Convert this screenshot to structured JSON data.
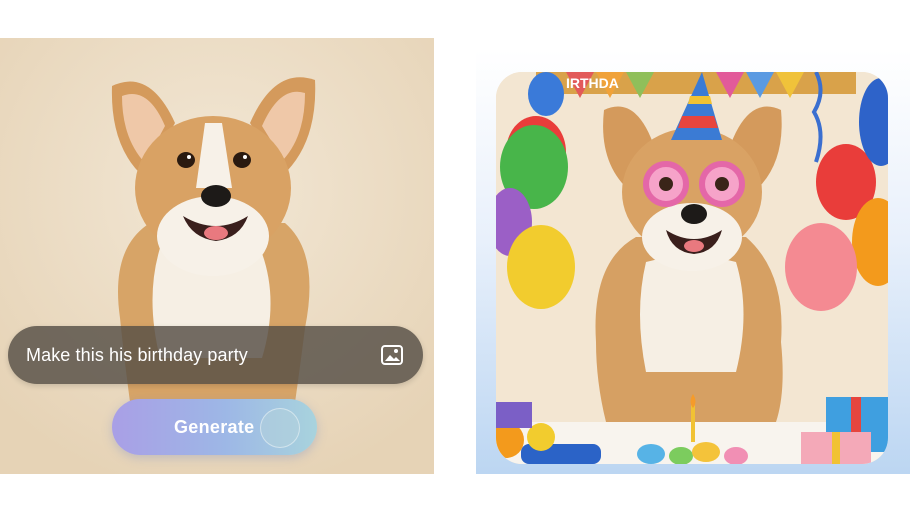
{
  "prompt": {
    "text": "Make this his birthday party",
    "attach_icon": "image-icon"
  },
  "generate": {
    "label": "Generate"
  },
  "source_image": {
    "subject": "corgi-photo"
  },
  "result_image": {
    "subject": "corgi-birthday-party-photo",
    "banner_text": "IRTHDA"
  },
  "colors": {
    "prompt_bar": "#564e46",
    "button_gradient_start": "#a99fe6",
    "button_gradient_end": "#a8d3dd",
    "frame_gradient": "#bcd6f2"
  }
}
